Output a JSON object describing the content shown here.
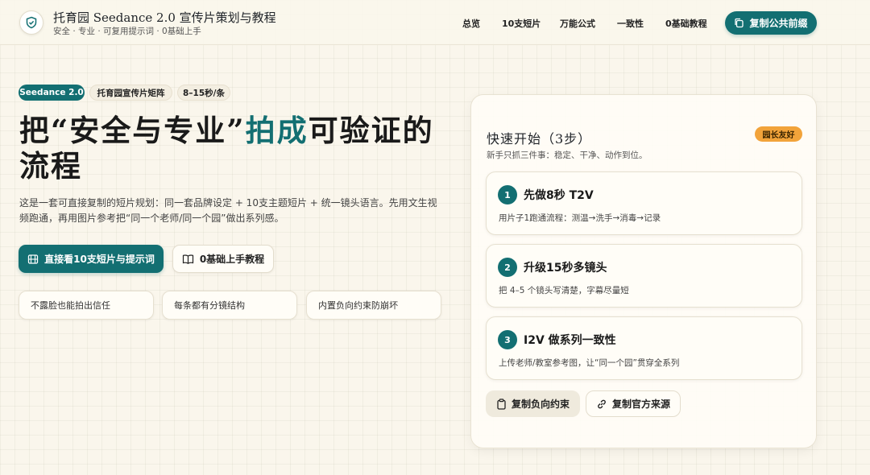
{
  "header": {
    "brand_title": "托育园 Seedance 2.0 宣传片策划与教程",
    "brand_subtitle": "安全 · 专业 · 可复用提示词 · 0基础上手",
    "nav": [
      "总览",
      "10支短片",
      "万能公式",
      "一致性",
      "0基础教程"
    ],
    "cta_label": "复制公共前缀"
  },
  "hero": {
    "chips": [
      "Seedance 2.0",
      "托育园宣传片矩阵",
      "8–15秒/条"
    ],
    "title_part1": "把“安全与专业”",
    "title_accent": "拍成",
    "title_part2": "可验证的流程",
    "description": "这是一套可直接复制的短片规划：同一套品牌设定 + 10支主题短片 + 统一镜头语言。先用文生视频跑通，再用图片参考把“同一个老师/同一个园”做出系列感。",
    "primary_button": "直接看10支短片与提示词",
    "secondary_button": "0基础上手教程",
    "features": [
      "不露脸也能拍出信任",
      "每条都有分镜结构",
      "内置负向约束防崩坏"
    ]
  },
  "quickstart": {
    "title": "快速开始（3步）",
    "badge": "园长友好",
    "subtitle": "新手只抓三件事：稳定、干净、动作到位。",
    "steps": [
      {
        "num": "1",
        "title": "先做8秒 T2V",
        "desc": "用片子1跑通流程：测温→洗手→消毒→记录"
      },
      {
        "num": "2",
        "title": "升级15秒多镜头",
        "desc": "把 4–5 个镜头写清楚，字幕尽量短"
      },
      {
        "num": "3",
        "title": "I2V 做系列一致性",
        "desc": "上传老师/教室参考图，让“同一个园”贯穿全系列"
      }
    ],
    "copy_negative": "复制负向约束",
    "copy_source": "复制官方来源"
  },
  "colors": {
    "accent": "#136f72",
    "badge": "#f2a33a",
    "background": "#faf6ec"
  }
}
